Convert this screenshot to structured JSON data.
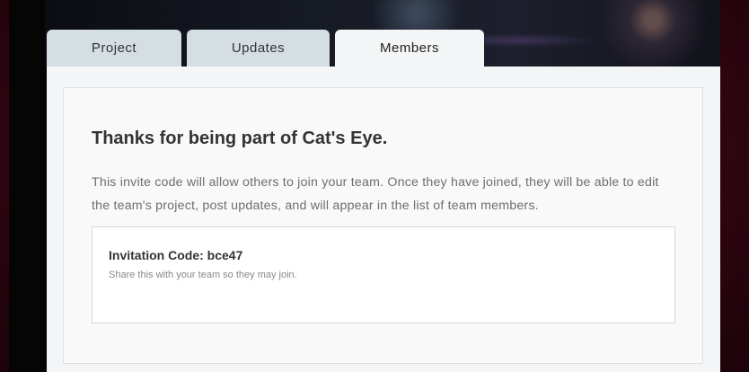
{
  "tabs": [
    {
      "label": "Project"
    },
    {
      "label": "Updates"
    },
    {
      "label": "Members",
      "active": true
    }
  ],
  "members": {
    "heading": "Thanks for being part of Cat's Eye.",
    "description": "This invite code will allow others to join your team. Once they have joined, they will be able to edit the team's project, post updates, and will appear in the list of team members.",
    "invitation": {
      "label": "Invitation Code:",
      "code": "bce47",
      "hint": "Share this with your team so they may join."
    }
  }
}
